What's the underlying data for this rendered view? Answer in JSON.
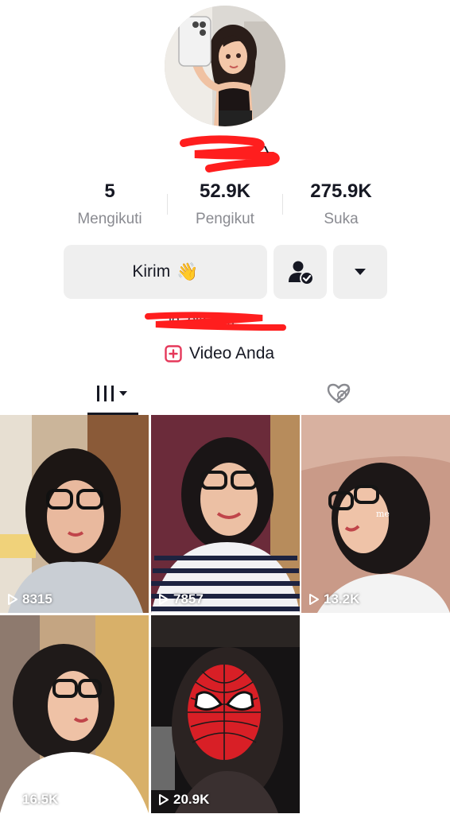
{
  "profile": {
    "avatar_icon": "avatar-illustration",
    "username": "",
    "bio": ""
  },
  "stats": [
    {
      "value": "5",
      "label": "Mengikuti"
    },
    {
      "value": "52.9K",
      "label": "Pengikut"
    },
    {
      "value": "275.9K",
      "label": "Suka"
    }
  ],
  "actions": {
    "message_label": "Kirim",
    "message_emoji": "👋",
    "follow_icon": "user-check-icon",
    "more_icon": "caret-down-icon"
  },
  "your_videos": {
    "icon": "plus-square-icon",
    "label": "Video Anda"
  },
  "tabs": [
    {
      "name": "videos",
      "icon": "grid-bars-icon",
      "active": true
    },
    {
      "name": "liked",
      "icon": "heart-hidden-icon",
      "active": false
    }
  ],
  "videos": [
    {
      "views": "8315"
    },
    {
      "views": "7857"
    },
    {
      "views": "13.2K"
    },
    {
      "views": "16.5K"
    },
    {
      "views": "20.9K"
    }
  ],
  "colors": {
    "text_primary": "#161823",
    "text_secondary": "#8a8b91",
    "button_bg": "#efefef",
    "accent_pink": "#e5385a",
    "redaction_red": "#ff1e1e"
  }
}
